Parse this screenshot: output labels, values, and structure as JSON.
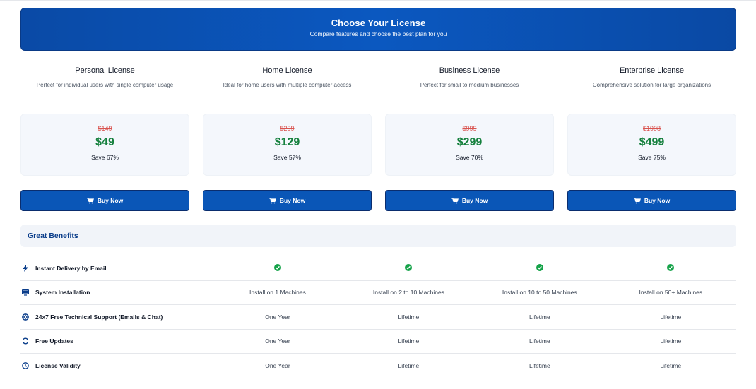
{
  "header": {
    "title": "Choose Your License",
    "subtitle": "Compare features and choose the best plan for you"
  },
  "plans": [
    {
      "name": "Personal License",
      "description": "Perfect for individual users with single computer usage",
      "old_price": "$149",
      "price": "$49",
      "save": "Save 67%",
      "button": "Buy Now"
    },
    {
      "name": "Home License",
      "description": "Ideal for home users with multiple computer access",
      "old_price": "$299",
      "price": "$129",
      "save": "Save 57%",
      "button": "Buy Now"
    },
    {
      "name": "Business License",
      "description": "Perfect for small to medium businesses",
      "old_price": "$999",
      "price": "$299",
      "save": "Save 70%",
      "button": "Buy Now"
    },
    {
      "name": "Enterprise License",
      "description": "Comprehensive solution for large organizations",
      "old_price": "$1998",
      "price": "$499",
      "save": "Save 75%",
      "button": "Buy Now"
    }
  ],
  "benefits": {
    "title": "Great Benefits",
    "rows": [
      {
        "icon": "lightning-icon",
        "label": "Instant Delivery by Email",
        "values": [
          "check",
          "check",
          "check",
          "check"
        ]
      },
      {
        "icon": "monitor-icon",
        "label": "System Installation",
        "values": [
          "Install on 1 Machines",
          "Install on 2 to 10 Machines",
          "Install on 10 to 50 Machines",
          "Install on 50+ Machines"
        ]
      },
      {
        "icon": "lifebuoy-icon",
        "label": "24x7 Free Technical Support (Emails & Chat)",
        "values": [
          "One Year",
          "Lifetime",
          "Lifetime",
          "Lifetime"
        ]
      },
      {
        "icon": "refresh-icon",
        "label": "Free Updates",
        "values": [
          "One Year",
          "Lifetime",
          "Lifetime",
          "Lifetime"
        ]
      },
      {
        "icon": "clock-icon",
        "label": "License Validity",
        "values": [
          "One Year",
          "Lifetime",
          "Lifetime",
          "Lifetime"
        ]
      }
    ]
  },
  "colors": {
    "primary": "#0a56b7",
    "price_green": "#15803d",
    "old_price_red": "#d9534f",
    "check_green": "#16a34a"
  }
}
